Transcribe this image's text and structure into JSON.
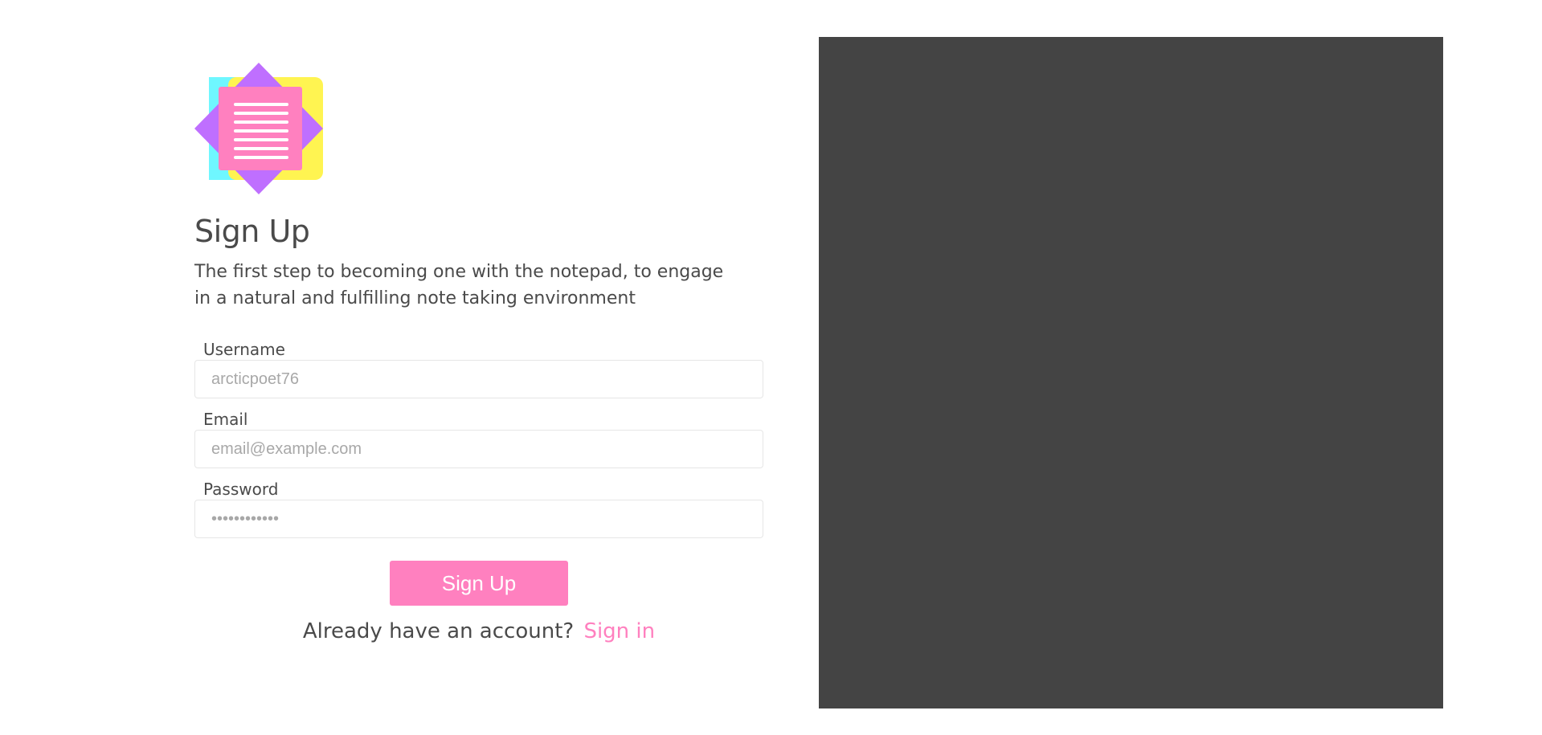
{
  "brand": {
    "logo_icon": "notepad-logo-icon",
    "colors": {
      "cyan": "#6ff7ff",
      "yellow": "#fff451",
      "purple": "#bf6fff",
      "pink": "#ff80bf"
    }
  },
  "header": {
    "title": "Sign Up",
    "subtitle": "The first step to becoming one with the notepad, to engage in a natural and fulfilling note taking environment"
  },
  "form": {
    "username": {
      "label": "Username",
      "placeholder": "arcticpoet76",
      "value": ""
    },
    "email": {
      "label": "Email",
      "placeholder": "email@example.com",
      "value": ""
    },
    "password": {
      "label": "Password",
      "placeholder": "••••••••••••",
      "value": ""
    },
    "submit_label": "Sign Up"
  },
  "footer": {
    "prompt": "Already have an account?",
    "link_label": "Sign in"
  },
  "colors": {
    "accent": "#ff80bf",
    "text": "#4a4a4a",
    "panel": "#444444"
  }
}
